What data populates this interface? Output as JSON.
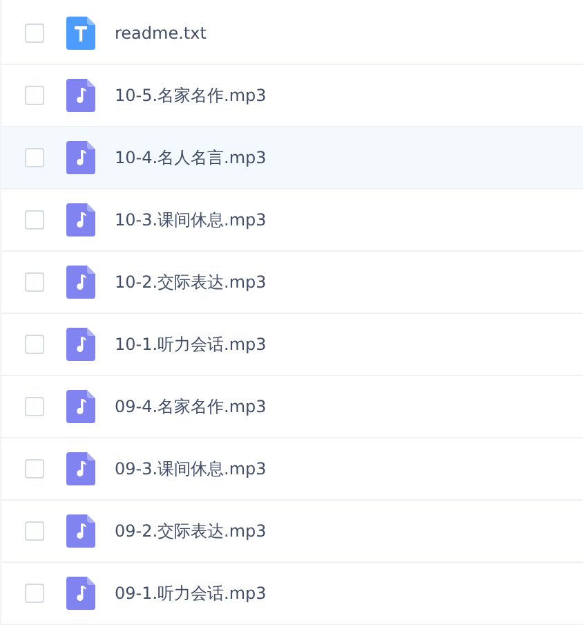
{
  "files": [
    {
      "name": "readme.txt",
      "kind": "text",
      "checked": false,
      "highlighted": false
    },
    {
      "name": "10-5.名家名作.mp3",
      "kind": "audio",
      "checked": false,
      "highlighted": false
    },
    {
      "name": "10-4.名人名言.mp3",
      "kind": "audio",
      "checked": false,
      "highlighted": true
    },
    {
      "name": "10-3.课间休息.mp3",
      "kind": "audio",
      "checked": false,
      "highlighted": false
    },
    {
      "name": "10-2.交际表达.mp3",
      "kind": "audio",
      "checked": false,
      "highlighted": false
    },
    {
      "name": "10-1.听力会话.mp3",
      "kind": "audio",
      "checked": false,
      "highlighted": false
    },
    {
      "name": "09-4.名家名作.mp3",
      "kind": "audio",
      "checked": false,
      "highlighted": false
    },
    {
      "name": "09-3.课间休息.mp3",
      "kind": "audio",
      "checked": false,
      "highlighted": false
    },
    {
      "name": "09-2.交际表达.mp3",
      "kind": "audio",
      "checked": false,
      "highlighted": false
    },
    {
      "name": "09-1.听力会话.mp3",
      "kind": "audio",
      "checked": false,
      "highlighted": false
    }
  ]
}
